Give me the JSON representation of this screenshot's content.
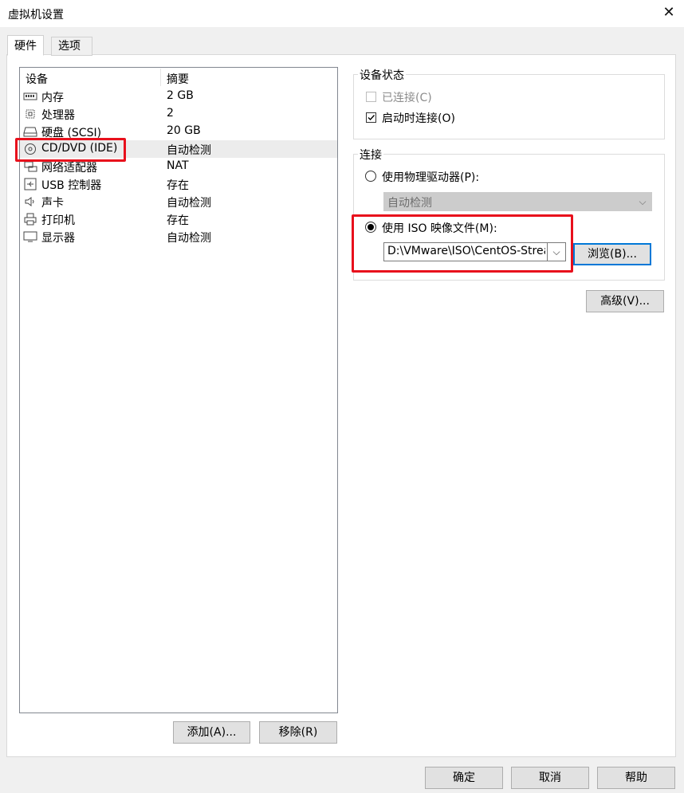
{
  "window": {
    "title": "虚拟机设置",
    "close": "✕"
  },
  "tabs": [
    {
      "label": "硬件"
    },
    {
      "label": "选项"
    }
  ],
  "device_list": {
    "headers": {
      "device": "设备",
      "summary": "摘要"
    },
    "rows": [
      {
        "name": "内存",
        "summary": "2 GB",
        "icon": "memory-icon"
      },
      {
        "name": "处理器",
        "summary": "2",
        "icon": "processor-icon"
      },
      {
        "name": "硬盘 (SCSI)",
        "summary": "20 GB",
        "icon": "hard-disk-icon"
      },
      {
        "name": "CD/DVD (IDE)",
        "summary": "自动检测",
        "icon": "cd-dvd-icon",
        "selected": true
      },
      {
        "name": "网络适配器",
        "summary": "NAT",
        "icon": "network-adapter-icon"
      },
      {
        "name": "USB 控制器",
        "summary": "存在",
        "icon": "usb-icon"
      },
      {
        "name": "声卡",
        "summary": "自动检测",
        "icon": "speaker-icon"
      },
      {
        "name": "打印机",
        "summary": "存在",
        "icon": "printer-icon"
      },
      {
        "name": "显示器",
        "summary": "自动检测",
        "icon": "monitor-icon"
      }
    ]
  },
  "list_buttons": {
    "add": "添加(A)...",
    "remove": "移除(R)"
  },
  "device_status": {
    "title": "设备状态",
    "connected": {
      "label": "已连接(C)",
      "checked": false,
      "enabled": false
    },
    "connect_at_power_on": {
      "label": "启动时连接(O)",
      "checked": true
    }
  },
  "connection": {
    "title": "连接",
    "physical": {
      "label": "使用物理驱动器(P):",
      "selected": false
    },
    "physical_value": "自动检测",
    "iso": {
      "label": "使用 ISO 映像文件(M):",
      "selected": true
    },
    "iso_path": "D:\\VMware\\ISO\\CentOS-Strea",
    "browse": "浏览(B)..."
  },
  "advanced_button": "高级(V)...",
  "footer": {
    "ok": "确定",
    "cancel": "取消",
    "help": "帮助"
  },
  "colors": {
    "highlight_box": "#e8101c",
    "focus_border": "#0078d7",
    "selected_row": "#ececec"
  }
}
